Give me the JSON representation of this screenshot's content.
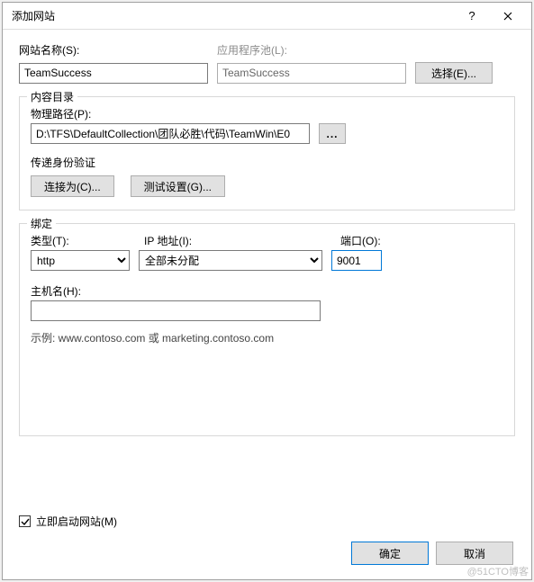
{
  "titlebar": {
    "title": "添加网站"
  },
  "siteName": {
    "label": "网站名称(S):",
    "value": "TeamSuccess"
  },
  "appPool": {
    "label": "应用程序池(L):",
    "value": "TeamSuccess",
    "selectBtn": "选择(E)..."
  },
  "contentDir": {
    "groupTitle": "内容目录",
    "physicalPath": {
      "label": "物理路径(P):",
      "value": "D:\\TFS\\DefaultCollection\\团队必胜\\代码\\TeamWin\\E0"
    },
    "authTitle": "传递身份验证",
    "connectAsBtn": "连接为(C)...",
    "testSettingsBtn": "测试设置(G)..."
  },
  "binding": {
    "groupTitle": "绑定",
    "typeLabel": "类型(T):",
    "typeValue": "http",
    "ipLabel": "IP 地址(I):",
    "ipValue": "全部未分配",
    "portLabel": "端口(O):",
    "portValue": "9001",
    "hostLabel": "主机名(H):",
    "hostValue": "",
    "example": "示例: www.contoso.com 或 marketing.contoso.com"
  },
  "startImmediately": {
    "label": "立即启动网站(M)",
    "checked": true
  },
  "footer": {
    "ok": "确定",
    "cancel": "取消"
  },
  "watermark": "@51CTO博客"
}
